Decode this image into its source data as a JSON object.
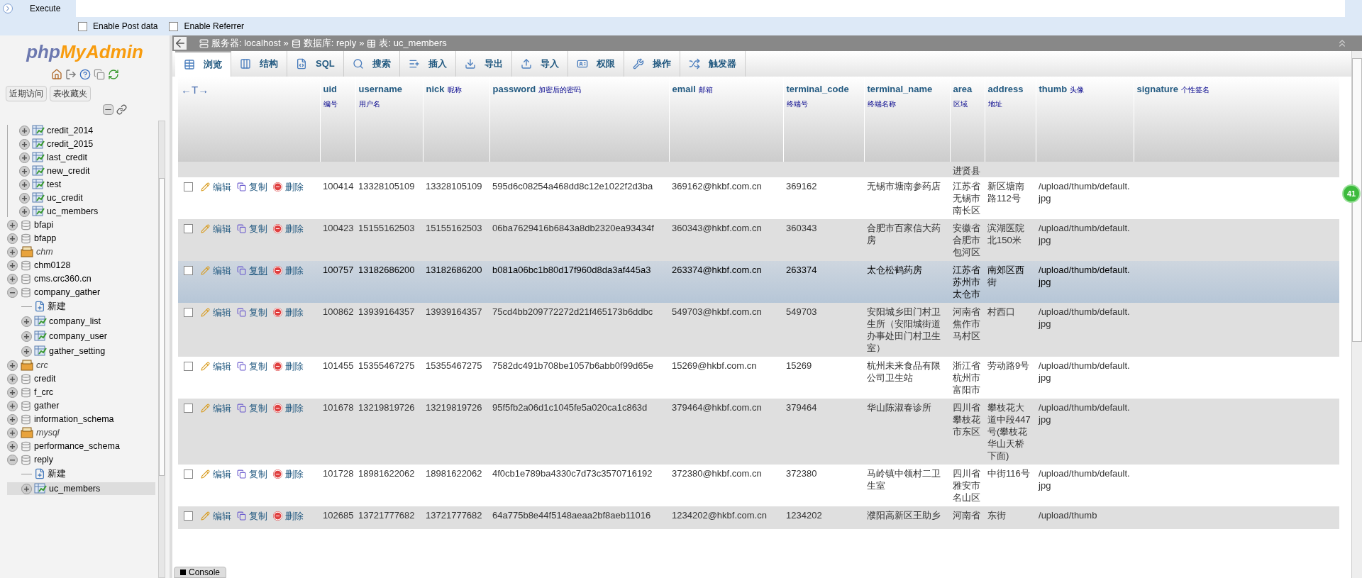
{
  "toolbar": {
    "execute": "Execute",
    "options": [
      {
        "label": "Enable Post data",
        "checked": false
      },
      {
        "label": "Enable Referrer",
        "checked": false
      }
    ]
  },
  "sidebar": {
    "logo": {
      "php": "php",
      "name": "MyAdmin"
    },
    "buttons": [
      "近期访问",
      "表收藏夹"
    ],
    "open_group": [
      {
        "name": "credit_2014"
      },
      {
        "name": "credit_2015"
      },
      {
        "name": "last_credit"
      },
      {
        "name": "new_credit"
      },
      {
        "name": "test"
      },
      {
        "name": "uc_credit"
      },
      {
        "name": "uc_members"
      }
    ],
    "databases": [
      {
        "name": "bfapi",
        "kind": "db",
        "expanded": false
      },
      {
        "name": "bfapp",
        "kind": "db",
        "expanded": false
      },
      {
        "name": "chm",
        "kind": "special",
        "expanded": false
      },
      {
        "name": "chm0128",
        "kind": "db",
        "expanded": false
      },
      {
        "name": "cms.crc360.cn",
        "kind": "db",
        "expanded": false
      },
      {
        "name": "company_gather",
        "kind": "db",
        "expanded": true,
        "children": [
          {
            "name": "新建",
            "kind": "new",
            "selected": false
          },
          {
            "name": "company_list",
            "kind": "table",
            "selected": false
          },
          {
            "name": "company_user",
            "kind": "table",
            "selected": false
          },
          {
            "name": "gather_setting",
            "kind": "table",
            "selected": false
          }
        ]
      },
      {
        "name": "crc",
        "kind": "special",
        "expanded": false
      },
      {
        "name": "credit",
        "kind": "db",
        "expanded": false
      },
      {
        "name": "f_crc",
        "kind": "db",
        "expanded": false
      },
      {
        "name": "gather",
        "kind": "db",
        "expanded": false
      },
      {
        "name": "information_schema",
        "kind": "db",
        "expanded": false
      },
      {
        "name": "mysql",
        "kind": "special",
        "expanded": false
      },
      {
        "name": "performance_schema",
        "kind": "db",
        "expanded": false
      },
      {
        "name": "reply",
        "kind": "db",
        "expanded": true,
        "children": [
          {
            "name": "新建",
            "kind": "new",
            "selected": false
          },
          {
            "name": "uc_members",
            "kind": "table",
            "selected": true
          }
        ]
      }
    ]
  },
  "breadcrumb": {
    "separator": "»",
    "items": [
      "服务器: localhost",
      "数据库: reply",
      "表: uc_members"
    ]
  },
  "tabs": [
    {
      "label": "浏览",
      "selected": true
    },
    {
      "label": "结构",
      "selected": false
    },
    {
      "label": "SQL",
      "selected": false
    },
    {
      "label": "搜索",
      "selected": false
    },
    {
      "label": "插入",
      "selected": false
    },
    {
      "label": "导出",
      "selected": false
    },
    {
      "label": "导入",
      "selected": false
    },
    {
      "label": "权限",
      "selected": false
    },
    {
      "label": "操作",
      "selected": false
    },
    {
      "label": "触发器",
      "selected": false
    }
  ],
  "table": {
    "resize_handle": "←T→",
    "columns": [
      {
        "name": "uid",
        "comment": "编号"
      },
      {
        "name": "username",
        "comment": "用户名"
      },
      {
        "name": "nick",
        "comment": "昵称"
      },
      {
        "name": "password",
        "comment": "加密后的密码"
      },
      {
        "name": "email",
        "comment": "邮箱"
      },
      {
        "name": "terminal_code",
        "comment": "终端号"
      },
      {
        "name": "terminal_name",
        "comment": "终端名称"
      },
      {
        "name": "area",
        "comment": "区域"
      },
      {
        "name": "address",
        "comment": "地址"
      },
      {
        "name": "thumb",
        "comment": "头像"
      },
      {
        "name": "signature",
        "comment": "个性签名"
      }
    ],
    "partial_row": {
      "area": "进贤县"
    },
    "rows": [
      {
        "selected": false,
        "checked": false,
        "actions": [
          "编辑",
          "复制",
          "删除"
        ],
        "cells": [
          "100414",
          "13328105109",
          "13328105109",
          "595d6c08254a468dd8c12e1022f2d3ba",
          "369162@hkbf.com.cn",
          "369162",
          "无锡市塘南参药店",
          "江苏省无锡市南长区",
          "新区塘南路112号",
          "/upload/thumb/default.jpg",
          ""
        ]
      },
      {
        "selected": false,
        "checked": false,
        "actions": [
          "编辑",
          "复制",
          "删除"
        ],
        "cells": [
          "100423",
          "15155162503",
          "15155162503",
          "06ba7629416b6843a8db2320ea93434f",
          "360343@hkbf.com.cn",
          "360343",
          "合肥市百家信大药房",
          "安徽省合肥市包河区",
          "滨湖医院北150米",
          "/upload/thumb/default.jpg",
          ""
        ]
      },
      {
        "selected": true,
        "checked": false,
        "actions": [
          "编辑",
          "复制",
          "删除"
        ],
        "cells": [
          "100757",
          "13182686200",
          "13182686200",
          "b081a06bc1b80d17f960d8da3af445a3",
          "263374@hkbf.com.cn",
          "263374",
          "太仓松鹤药房",
          "江苏省苏州市太仓市",
          "南郊区西街",
          "/upload/thumb/default.jpg",
          ""
        ]
      },
      {
        "selected": false,
        "checked": false,
        "actions": [
          "编辑",
          "复制",
          "删除"
        ],
        "cells": [
          "100862",
          "13939164357",
          "13939164357",
          "75cd4bb209772272d21f465173b6ddbc",
          "549703@hkbf.com.cn",
          "549703",
          "安阳城乡田门村卫生所（安阳城街道办事处田门村卫生室）",
          "河南省焦作市马村区",
          "村西口",
          "/upload/thumb/default.jpg",
          ""
        ]
      },
      {
        "selected": false,
        "checked": false,
        "actions": [
          "编辑",
          "复制",
          "删除"
        ],
        "cells": [
          "101455",
          "15355467275",
          "15355467275",
          "7582dc491b708be1057b6abb0f99d65e",
          "15269@hkbf.com.cn",
          "15269",
          "杭州未来食品有限公司卫生站",
          "浙江省杭州市富阳市",
          "劳动路9号",
          "/upload/thumb/default.jpg",
          ""
        ]
      },
      {
        "selected": false,
        "checked": false,
        "actions": [
          "编辑",
          "复制",
          "删除"
        ],
        "cells": [
          "101678",
          "13219819726",
          "13219819726",
          "95f5fb2a06d1c1045fe5a020ca1c863d",
          "379464@hkbf.com.cn",
          "379464",
          "华山陈淑春诊所",
          "四川省攀枝花市东区",
          "攀枝花大道中段447号(攀枝花华山天桥下面)",
          "/upload/thumb/default.jpg",
          ""
        ]
      },
      {
        "selected": false,
        "checked": false,
        "actions": [
          "编辑",
          "复制",
          "删除"
        ],
        "cells": [
          "101728",
          "18981622062",
          "18981622062",
          "4f0cb1e789ba4330c7d73c3570716192",
          "372380@hkbf.com.cn",
          "372380",
          "马岭镇中领村二卫生室",
          "四川省雅安市名山区",
          "中街116号",
          "/upload/thumb/default.jpg",
          ""
        ]
      },
      {
        "selected": false,
        "checked": false,
        "actions": [
          "编辑",
          "复制",
          "删除"
        ],
        "cells": [
          "102685",
          "13721777682",
          "13721777682",
          "64a775b8e44f5148aeaa2bf8aeb11016",
          "1234202@hkbf.com.cn",
          "1234202",
          "濮阳高新区王助乡",
          "河南省",
          "东街",
          "/upload/thumb",
          ""
        ]
      }
    ]
  },
  "console": "Console",
  "badge": "41"
}
